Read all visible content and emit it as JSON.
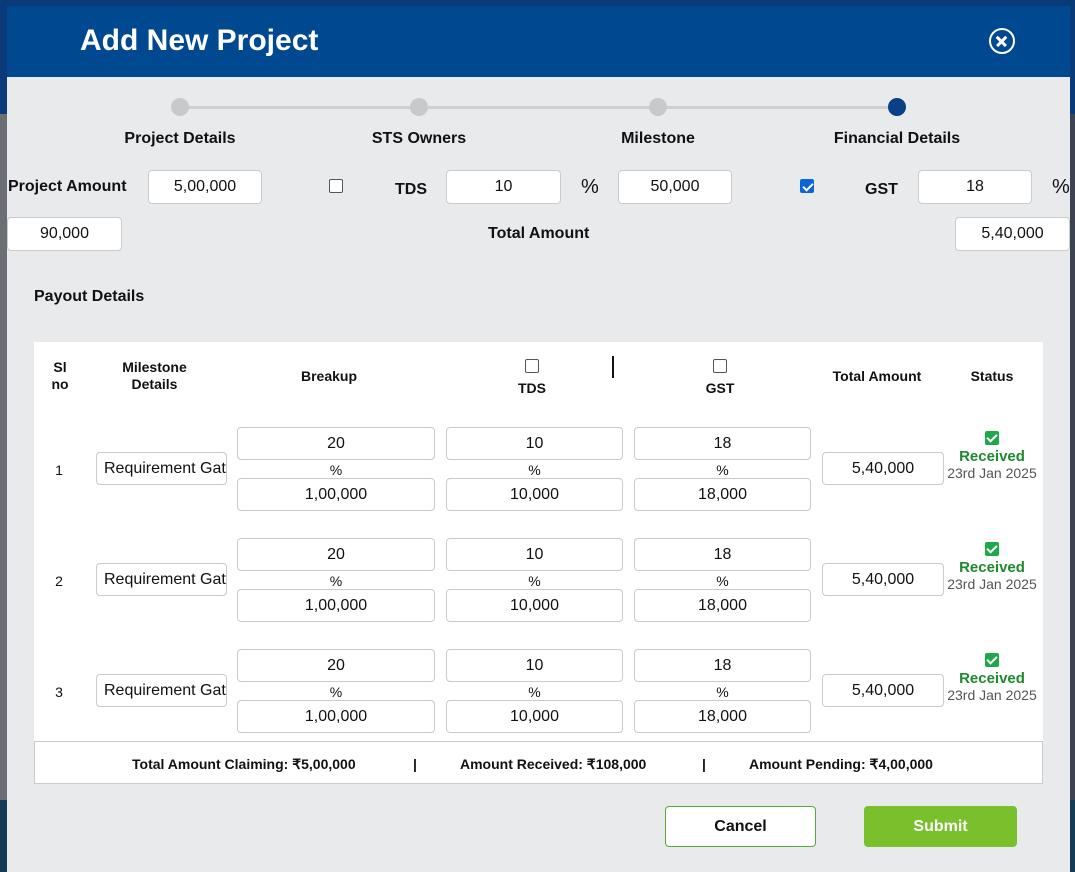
{
  "modal": {
    "title": "Add New Project"
  },
  "stepper": {
    "steps": [
      {
        "label": "Project Details",
        "active": false
      },
      {
        "label": "STS Owners",
        "active": false
      },
      {
        "label": "Milestone",
        "active": false
      },
      {
        "label": "Financial Details",
        "active": true
      }
    ]
  },
  "financial": {
    "project_amount_label": "Project Amount",
    "project_amount": "5,00,000",
    "tds_checked": false,
    "tds_label": "TDS",
    "tds_percent": "10",
    "tds_percent_symbol": "%",
    "tds_amount": "50,000",
    "gst_checked": true,
    "gst_label": "GST",
    "gst_percent": "18",
    "gst_percent_symbol": "%",
    "gst_amount": "90,000",
    "total_amount_label": "Total Amount",
    "total_amount": "5,40,000"
  },
  "payout": {
    "title": "Payout Details",
    "headers": {
      "sl_no": "Sl no",
      "milestone": "Milestone Details",
      "breakup": "Breakup",
      "tds": "TDS",
      "gst": "GST",
      "total_amount": "Total Amount",
      "status": "Status"
    },
    "rows": [
      {
        "sl": "1",
        "milestone": "Requirement Gathering",
        "breakup_pct": "20",
        "breakup_amt": "1,00,000",
        "tds_pct": "10",
        "tds_amt": "10,000",
        "gst_pct": "18",
        "gst_amt": "18,000",
        "pct_symbol": "%",
        "total": "5,40,000",
        "status": "Received",
        "date": "23rd Jan 2025"
      },
      {
        "sl": "2",
        "milestone": "Requirement Gathering",
        "breakup_pct": "20",
        "breakup_amt": "1,00,000",
        "tds_pct": "10",
        "tds_amt": "10,000",
        "gst_pct": "18",
        "gst_amt": "18,000",
        "pct_symbol": "%",
        "total": "5,40,000",
        "status": "Received",
        "date": "23rd Jan 2025"
      },
      {
        "sl": "3",
        "milestone": "Requirement Gathering",
        "breakup_pct": "20",
        "breakup_amt": "1,00,000",
        "tds_pct": "10",
        "tds_amt": "10,000",
        "gst_pct": "18",
        "gst_amt": "18,000",
        "pct_symbol": "%",
        "total": "5,40,000",
        "status": "Received",
        "date": "23rd Jan 2025"
      }
    ],
    "totals": {
      "claiming": "Total Amount Claiming: ₹5,00,000",
      "received": "Amount Received: ₹108,000",
      "pending": "Amount Pending: ₹4,00,000",
      "separator": "|"
    }
  },
  "actions": {
    "cancel": "Cancel",
    "submit": "Submit"
  },
  "colors": {
    "header": "#004990",
    "active_step": "#0b3f86",
    "submit": "#79c02c",
    "received": "#1e8a2f"
  }
}
